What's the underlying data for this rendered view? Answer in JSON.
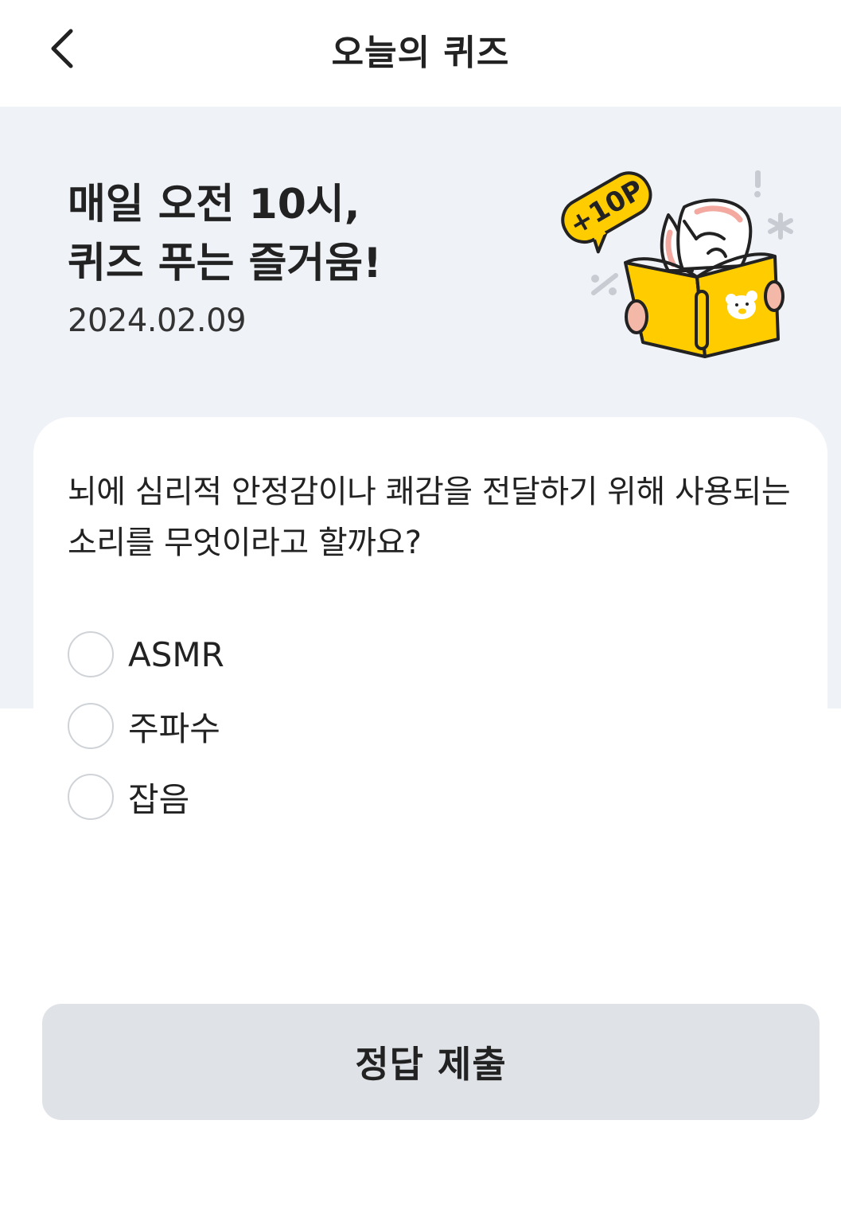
{
  "header": {
    "back_icon": "chevron-left-icon",
    "title": "오늘의 퀴즈"
  },
  "hero": {
    "title_line1": "매일 오전 10시,",
    "title_line2": "퀴즈 푸는 즐거움!",
    "date": "2024.02.09",
    "badge_text": "+10P",
    "illustration": "character-reading-book-icon"
  },
  "quiz": {
    "question_line1": "뇌에 심리적 안정감이나 쾌감을 전달하기 위해 사용되는",
    "question_line2": "소리를 무엇이라고 할까요?",
    "options": [
      {
        "label": "ASMR",
        "selected": false
      },
      {
        "label": "주파수",
        "selected": false
      },
      {
        "label": "잡음",
        "selected": false
      }
    ]
  },
  "submit": {
    "label": "정답 제출"
  },
  "colors": {
    "hero_background": "#eff2f7",
    "accent_yellow": "#ffcc00",
    "button_background": "#dfe2e6",
    "radio_border": "#cfd3d8"
  }
}
